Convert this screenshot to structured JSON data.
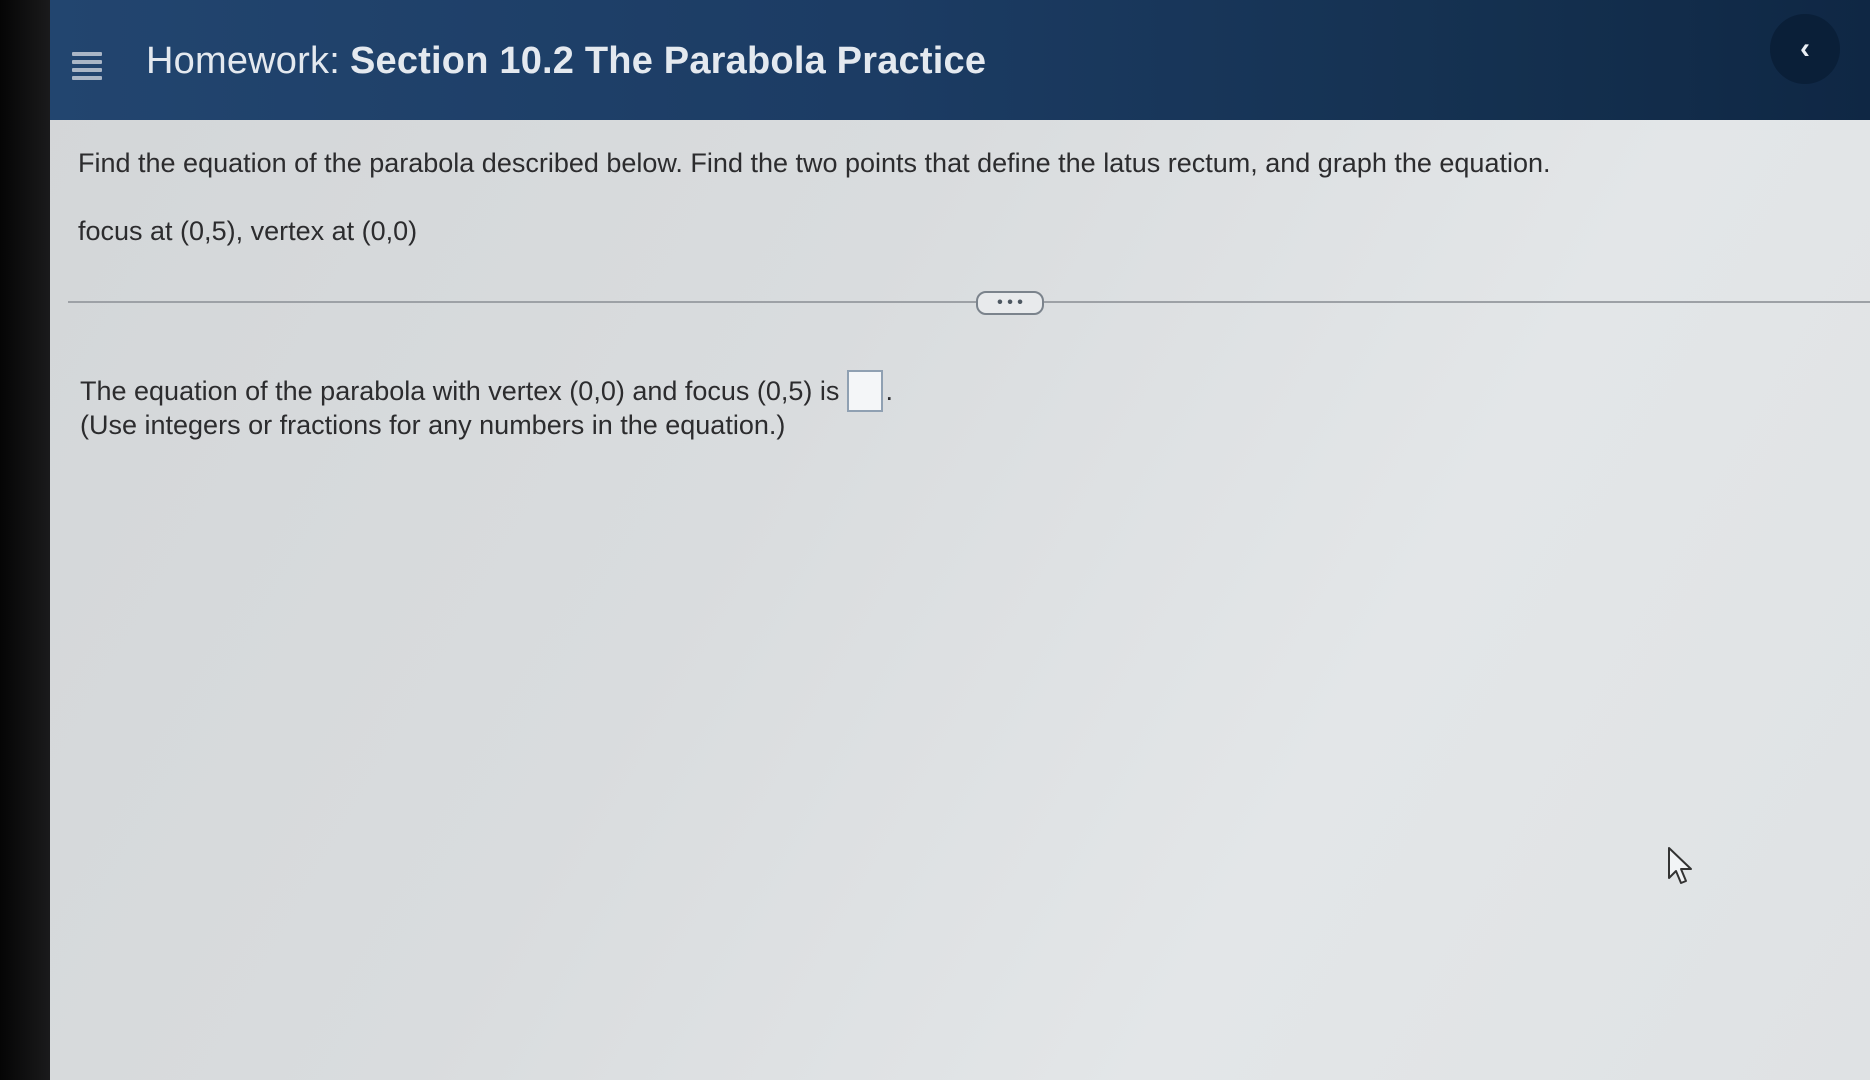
{
  "header": {
    "title_prefix": "Homework:",
    "title_section": "Section 10.2 The Parabola Practice",
    "menu_icon": "hamburger-menu-icon",
    "collapse_symbol": "‹",
    "colors": {
      "header_bg": "#1c3c64",
      "collapse_bg": "#0a1f38"
    }
  },
  "problem": {
    "instruction": "Find the equation of the parabola described below. Find the two points that define the latus rectum, and graph the equation.",
    "given": "focus at (0,5), vertex at (0,0)"
  },
  "more_button": {
    "label": "• • •"
  },
  "answer": {
    "prompt": "The equation of the parabola with vertex (0,0) and focus (0,5) is",
    "value": "",
    "period": ".",
    "hint": "(Use integers or fractions for any numbers in the equation.)"
  }
}
